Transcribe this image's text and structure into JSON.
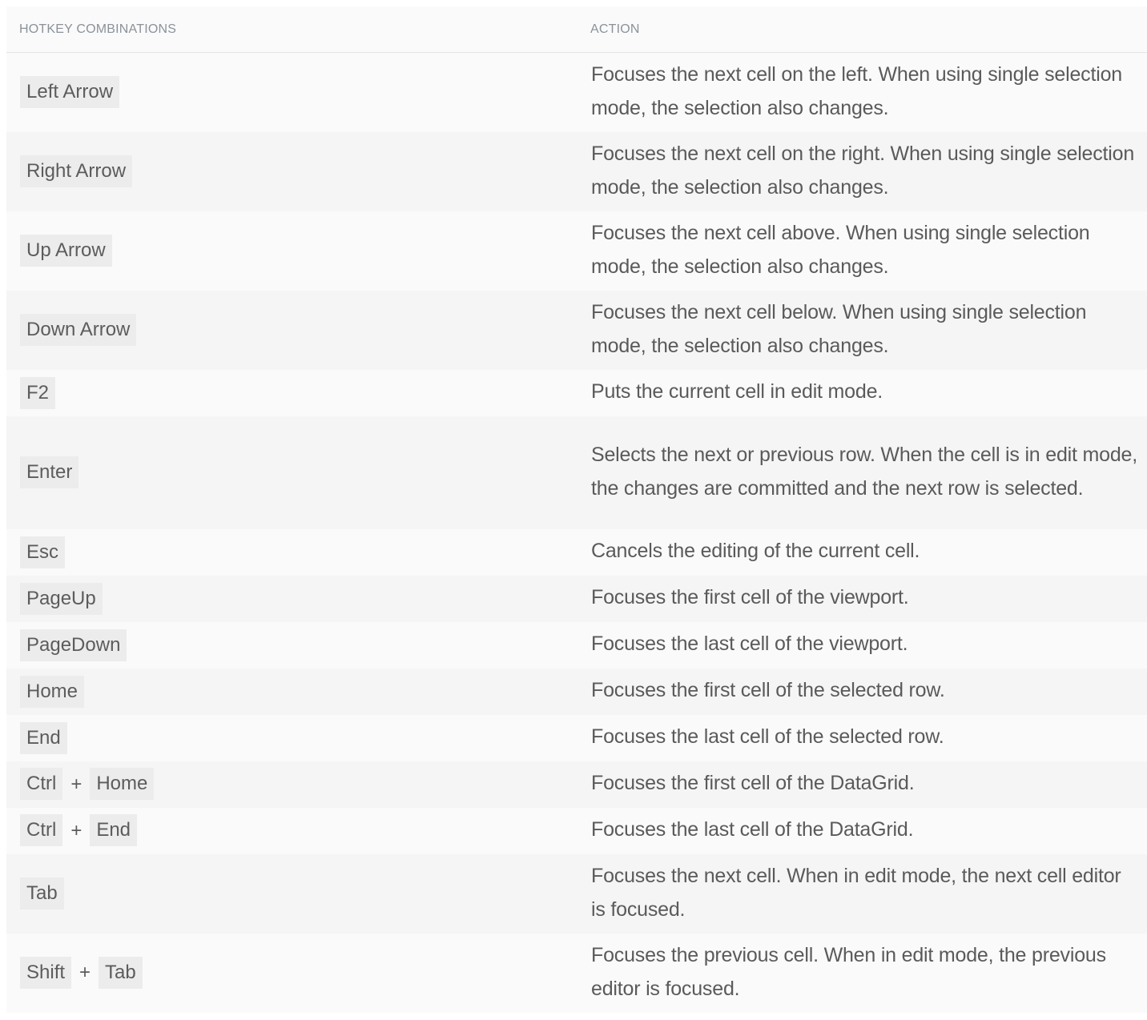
{
  "table": {
    "headers": {
      "hotkeys": "Hotkey Combinations",
      "action": "Action"
    },
    "rows": [
      {
        "keys": [
          "Left Arrow"
        ],
        "action": "Focuses the next cell on the left. When using single selection mode, the selection also changes.",
        "lines": 2
      },
      {
        "keys": [
          "Right Arrow"
        ],
        "action": "Focuses the next cell on the right. When using single selection mode, the selection also changes.",
        "lines": 2
      },
      {
        "keys": [
          "Up Arrow"
        ],
        "action": "Focuses the next cell above. When using single selection mode, the selection also changes.",
        "lines": 2
      },
      {
        "keys": [
          "Down Arrow"
        ],
        "action": "Focuses the next cell below. When using single selection mode, the selection also changes.",
        "lines": 2
      },
      {
        "keys": [
          "F2"
        ],
        "action": "Puts the current cell in edit mode.",
        "lines": 1
      },
      {
        "keys": [
          "Enter"
        ],
        "action": "Selects the next or previous row. When the cell is in edit mode, the changes are committed and the next row is selected.",
        "lines": 3
      },
      {
        "keys": [
          "Esc"
        ],
        "action": "Cancels the editing of the current cell.",
        "lines": 1
      },
      {
        "keys": [
          "PageUp"
        ],
        "action": "Focuses the first cell of the viewport.",
        "lines": 1
      },
      {
        "keys": [
          "PageDown"
        ],
        "action": "Focuses the last cell of the viewport.",
        "lines": 1
      },
      {
        "keys": [
          "Home"
        ],
        "action": "Focuses the first cell of the selected row.",
        "lines": 1
      },
      {
        "keys": [
          "End"
        ],
        "action": "Focuses the last cell of the selected row.",
        "lines": 1
      },
      {
        "keys": [
          "Ctrl",
          "Home"
        ],
        "action": "Focuses the first cell of the DataGrid.",
        "lines": 1
      },
      {
        "keys": [
          "Ctrl",
          "End"
        ],
        "action": "Focuses the last cell of the DataGrid.",
        "lines": 1
      },
      {
        "keys": [
          "Tab"
        ],
        "action": "Focuses the next cell. When in edit mode, the next cell editor is focused.",
        "lines": 2
      },
      {
        "keys": [
          "Shift",
          "Tab"
        ],
        "action": "Focuses the previous cell. When in edit mode, the previous editor is focused.",
        "lines": 2
      }
    ],
    "key_separator": "+"
  }
}
